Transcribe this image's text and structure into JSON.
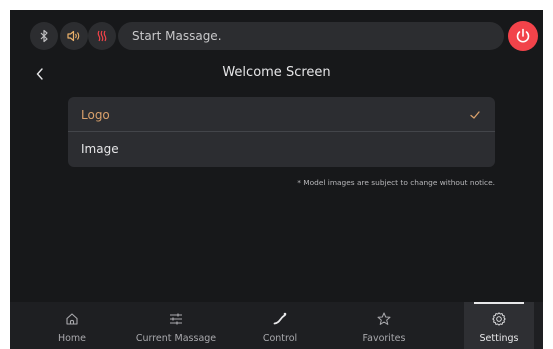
{
  "colors": {
    "background": "#17181a",
    "accent": "#d9a06b",
    "power": "#f2434a",
    "bluetooth": "#bdbdbf",
    "sound": "#e8b06a",
    "heat": "#f2434a"
  },
  "topbar": {
    "icons": [
      "bluetooth-icon",
      "speaker-icon",
      "heat-icon"
    ],
    "status_text": "Start Massage.",
    "power_icon": "power-icon"
  },
  "header": {
    "title": "Welcome Screen"
  },
  "options": [
    {
      "label": "Logo",
      "selected": true
    },
    {
      "label": "Image",
      "selected": false
    }
  ],
  "note": "* Model images are subject to change without notice.",
  "nav": {
    "items": [
      {
        "label": "Home",
        "icon": "home-icon",
        "active": false
      },
      {
        "label": "Current Massage",
        "icon": "sliders-icon",
        "active": false
      },
      {
        "label": "Control",
        "icon": "control-curve-icon",
        "active": false
      },
      {
        "label": "Favorites",
        "icon": "star-icon",
        "active": false
      },
      {
        "label": "Settings",
        "icon": "gear-icon",
        "active": true
      }
    ]
  }
}
